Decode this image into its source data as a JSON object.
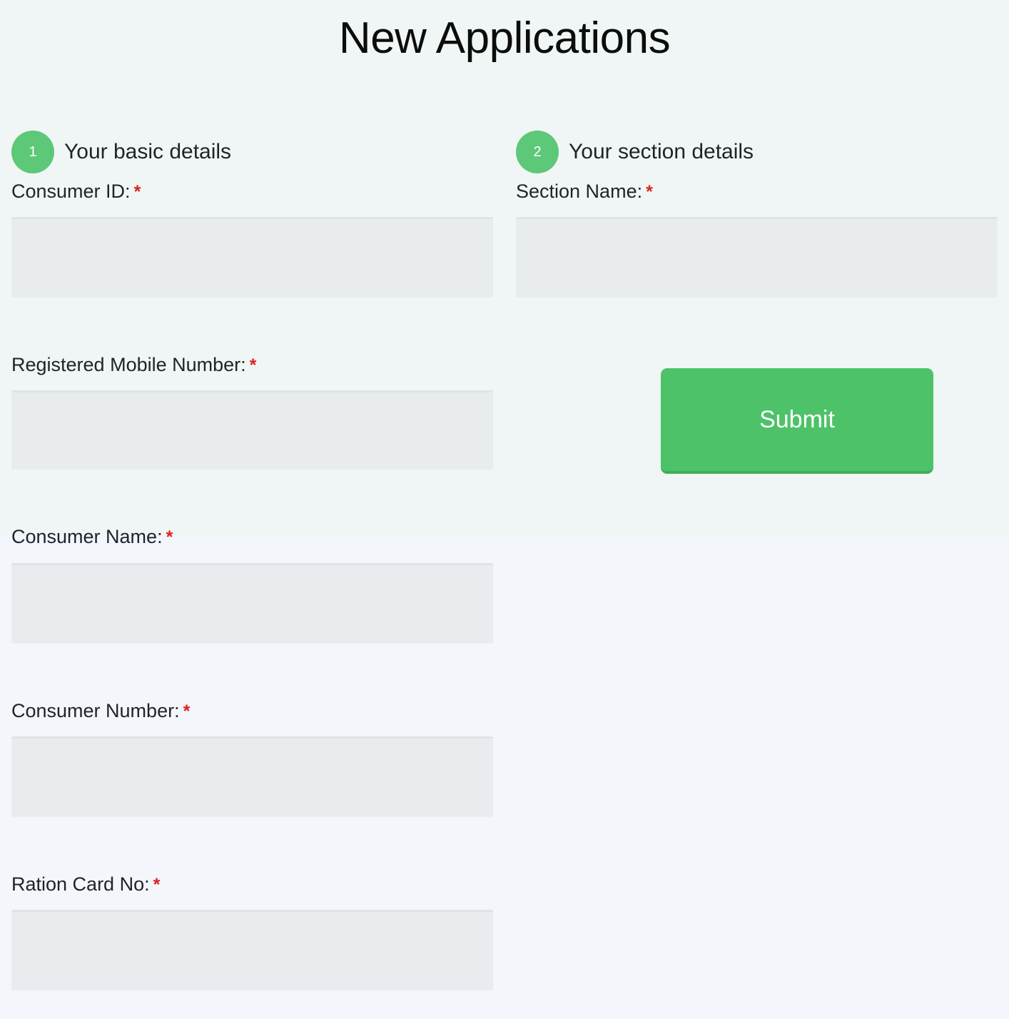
{
  "page": {
    "title": "New Applications",
    "background_color": "#f3f6fa",
    "background_color_top": "#f0f6f5"
  },
  "theme": {
    "accent_green": "#4dc268",
    "badge_green": "#5cc878",
    "required_red": "#e02020",
    "input_fill": "#e9ecef"
  },
  "steps": [
    {
      "number": "1",
      "label": "Your basic details"
    },
    {
      "number": "2",
      "label": "Your section details"
    }
  ],
  "basic_details": {
    "fields": [
      {
        "label": "Consumer ID:",
        "required_mark": "*",
        "value": "",
        "placeholder": ""
      },
      {
        "label": "Registered Mobile Number:",
        "required_mark": "*",
        "value": "",
        "placeholder": ""
      },
      {
        "label": "Consumer Name:",
        "required_mark": "*",
        "value": "",
        "placeholder": ""
      },
      {
        "label": "Consumer Number:",
        "required_mark": "*",
        "value": "",
        "placeholder": ""
      },
      {
        "label": "Ration Card No:",
        "required_mark": "*",
        "value": "",
        "placeholder": ""
      }
    ]
  },
  "section_details": {
    "fields": [
      {
        "label": "Section Name:",
        "required_mark": "*",
        "value": "",
        "placeholder": ""
      }
    ],
    "submit_label": "Submit"
  }
}
